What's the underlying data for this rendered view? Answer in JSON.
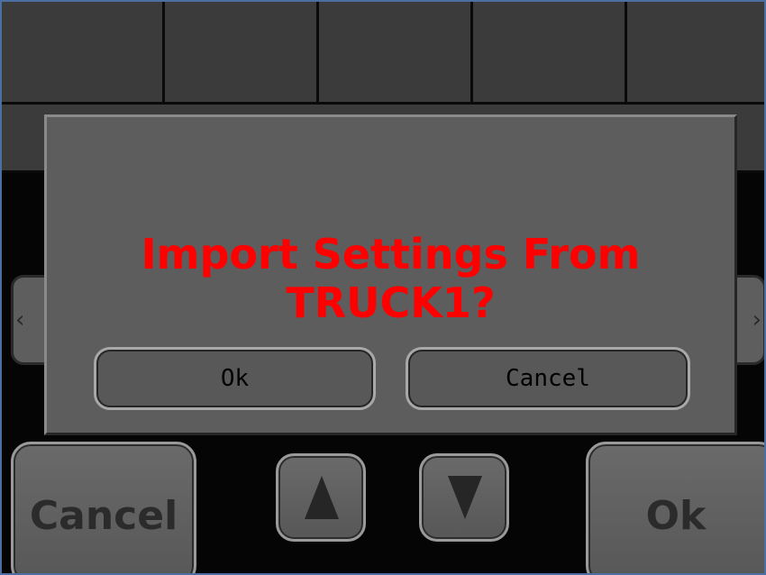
{
  "dialog": {
    "message": "Import Settings From TRUCK1?",
    "ok_label": "Ok",
    "cancel_label": "Cancel"
  },
  "bottom_bar": {
    "cancel_label": "Cancel",
    "ok_label": "Ok",
    "up_icon": "arrow-up-icon",
    "down_icon": "arrow-down-icon"
  },
  "colors": {
    "message_text": "#ff0000",
    "dialog_background": "#5d5d5d",
    "screen_background": "#050505"
  }
}
